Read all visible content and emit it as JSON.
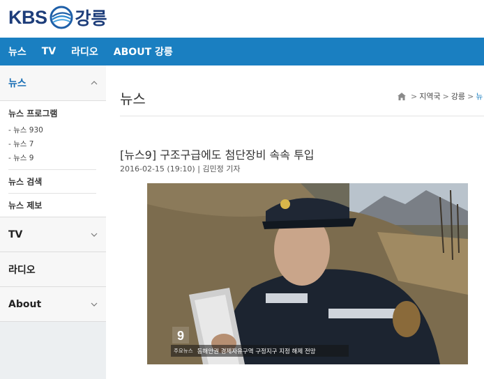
{
  "header": {
    "logo_text": "KBS",
    "region": "강릉"
  },
  "nav": {
    "items": [
      "뉴스",
      "TV",
      "라디오",
      "ABOUT 강릉"
    ]
  },
  "sidebar": {
    "news": {
      "label": "뉴스",
      "program_title": "뉴스 프로그램",
      "programs": [
        "- 뉴스 930",
        "- 뉴스 7",
        "- 뉴스 9"
      ],
      "search": "뉴스 검색",
      "tip": "뉴스 제보"
    },
    "sections": [
      "TV",
      "라디오",
      "About"
    ]
  },
  "page": {
    "title": "뉴스",
    "breadcrumb": [
      "지역국",
      "강릉",
      "뉴"
    ]
  },
  "article": {
    "title": "[뉴스9] 구조구급에도 첨단장비 속속 투입",
    "date": "2016-02-15 (19:10)",
    "reporter": "| 김민정 기자",
    "video_label": "주요뉴스",
    "video_caption": "동해안권 경제자유구역 구정지구 지정 해제 전망"
  },
  "colors": {
    "brand": "#1a7fc1",
    "logo": "#1d3d7a",
    "active_link": "#1a6fb5"
  }
}
